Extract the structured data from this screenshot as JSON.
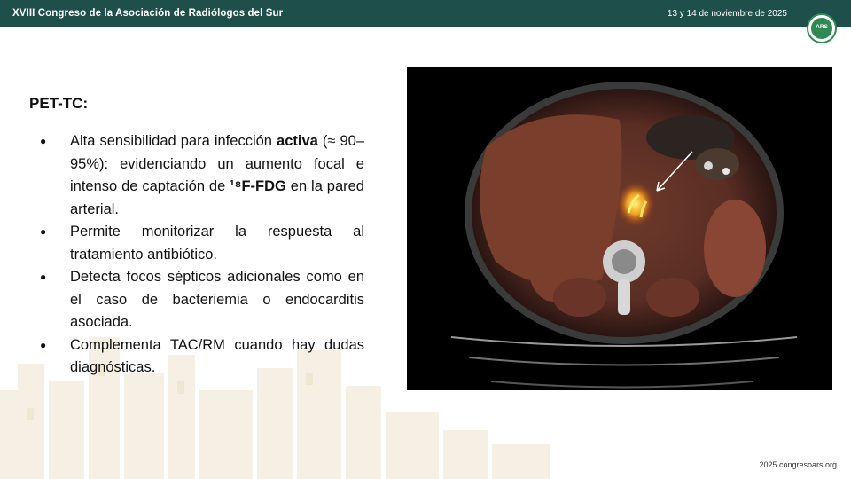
{
  "header": {
    "title": "XVIII Congreso de la Asociación de Radiólogos del Sur",
    "date": "13 y 14 de noviembre de 2025",
    "logo_text": "ARS"
  },
  "slide": {
    "heading": "PET-TC:",
    "bullets": [
      {
        "parts": [
          {
            "text": "Alta sensibilidad para infección ",
            "bold": false
          },
          {
            "text": "activa",
            "bold": true
          },
          {
            "text": " (≈ 90–95%): evidenciando un aumento focal e intenso de captación de ",
            "bold": false
          },
          {
            "text": "¹⁸F-FDG",
            "bold": true
          },
          {
            "text": " en la pared arterial.",
            "bold": false
          }
        ]
      },
      {
        "parts": [
          {
            "text": "Permite monitorizar la respuesta al tratamiento antibiótico.",
            "bold": false
          }
        ]
      },
      {
        "parts": [
          {
            "text": "Detecta focos sépticos adicionales como en el caso de bacteriemia o endocarditis asociada.",
            "bold": false
          }
        ]
      },
      {
        "parts": [
          {
            "text": "Complementa TAC/RM cuando hay dudas diagnósticas.",
            "bold": false
          }
        ]
      }
    ],
    "bullet_glyph": "●"
  },
  "footer": {
    "url": "2025.congresoars.org"
  },
  "colors": {
    "header_bg": "#1f4f4a",
    "logo_green": "#2e8a52"
  }
}
